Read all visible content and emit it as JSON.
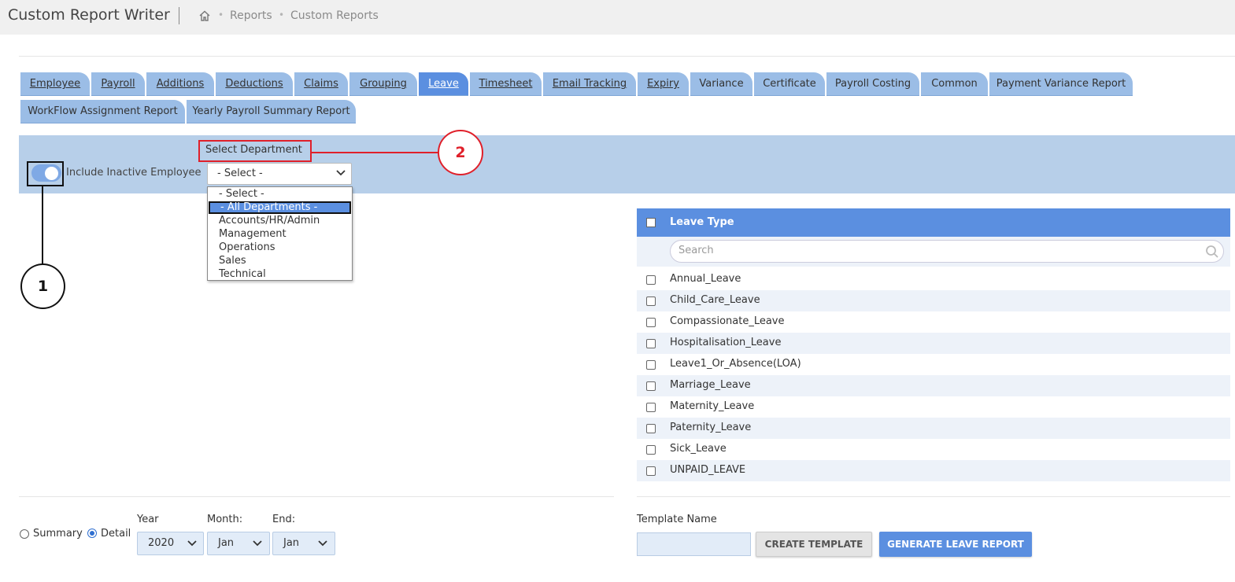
{
  "header": {
    "app_title": "Custom Report Writer",
    "breadcrumb": [
      "Reports",
      "Custom Reports"
    ]
  },
  "tabs": [
    {
      "label": "Employee",
      "active": false
    },
    {
      "label": "Payroll",
      "active": false
    },
    {
      "label": "Additions",
      "active": false
    },
    {
      "label": "Deductions",
      "active": false
    },
    {
      "label": "Claims",
      "active": false
    },
    {
      "label": "Grouping",
      "active": false
    },
    {
      "label": "Leave",
      "active": true
    },
    {
      "label": "Timesheet",
      "active": false
    },
    {
      "label": "Email Tracking",
      "active": false
    },
    {
      "label": "Expiry",
      "active": false
    },
    {
      "label": "Variance",
      "active": false
    },
    {
      "label": "Certificate",
      "active": false
    },
    {
      "label": "Payroll Costing",
      "active": false
    },
    {
      "label": "Common",
      "active": false
    },
    {
      "label": "Payment Variance Report",
      "active": false
    },
    {
      "label": "WorkFlow Assignment Report",
      "active": false
    },
    {
      "label": "Yearly Payroll Summary Report",
      "active": false
    }
  ],
  "filters": {
    "include_inactive_label": "Include Inactive Employee",
    "include_inactive_on": true,
    "department_label": "Select Department",
    "department_value": "- Select -",
    "department_options": [
      "- Select -",
      "- All Departments -",
      "Accounts/HR/Admin",
      "Management",
      "Operations",
      "Sales",
      "Technical"
    ],
    "department_highlighted": "- All Departments -"
  },
  "callouts": {
    "one": "1",
    "two": "2"
  },
  "leave_types": {
    "header": "Leave Type",
    "search_placeholder": "Search",
    "items": [
      "Annual_Leave",
      "Child_Care_Leave",
      "Compassionate_Leave",
      "Hospitalisation_Leave",
      "Leave1_Or_Absence(LOA)",
      "Marriage_Leave",
      "Maternity_Leave",
      "Paternity_Leave",
      "Sick_Leave",
      "UNPAID_LEAVE"
    ]
  },
  "report_options": {
    "summary_label": "Summary",
    "detail_label": "Detail",
    "selected_mode": "Detail",
    "year_label": "Year",
    "year_value": "2020",
    "month_label": "Month:",
    "month_value": "Jan",
    "end_label": "End:",
    "end_value": "Jan"
  },
  "template": {
    "name_label": "Template Name",
    "name_value": "",
    "create_label": "CREATE TEMPLATE",
    "generate_label": "GENERATE LEAVE REPORT"
  },
  "colors": {
    "accent": "#5b8fe0",
    "tab_bg": "#9bbde6",
    "panel_bg": "#b7cfe9",
    "callout_red": "#e0202a"
  }
}
